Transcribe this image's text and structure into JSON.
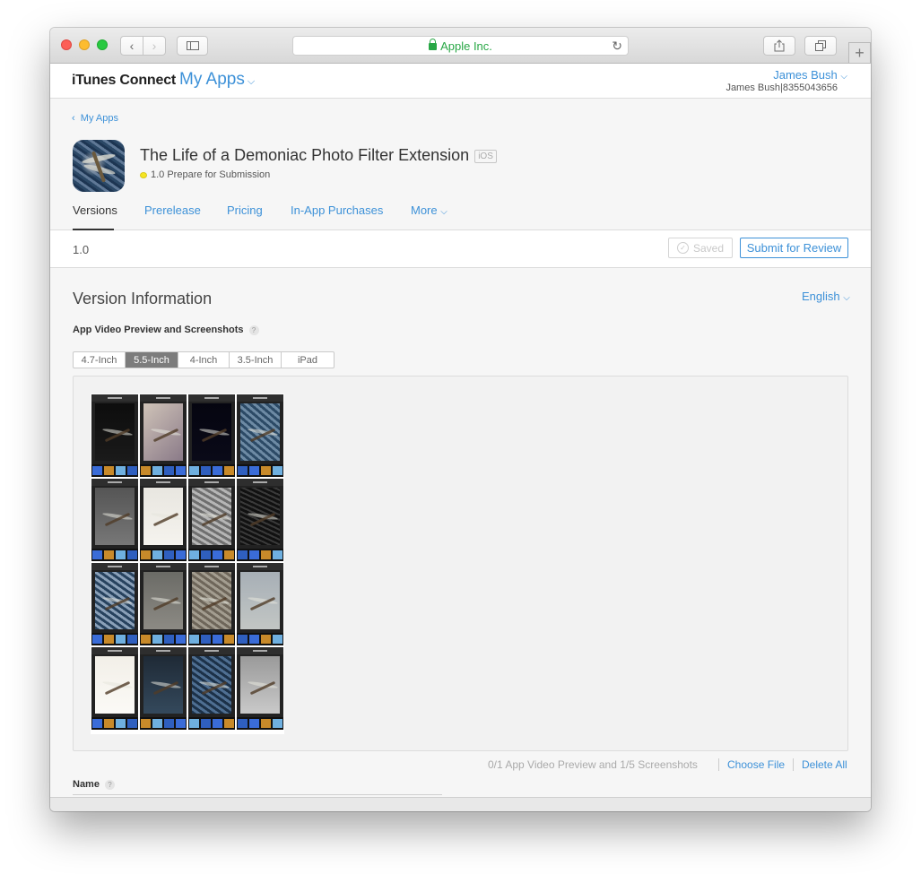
{
  "browser": {
    "address": "Apple Inc."
  },
  "header": {
    "brand": "iTunes Connect",
    "my_apps": "My Apps",
    "user_name": "James Bush",
    "user_id": "James Bush|8355043656"
  },
  "app": {
    "breadcrumb": "My Apps",
    "title": "The Life of a Demoniac Photo Filter Extension",
    "platform": "iOS",
    "status": "1.0 Prepare for Submission",
    "status_color": "#f6e523",
    "tabs": [
      {
        "label": "Versions",
        "active": true
      },
      {
        "label": "Prerelease"
      },
      {
        "label": "Pricing"
      },
      {
        "label": "In-App Purchases"
      },
      {
        "label": "More"
      }
    ]
  },
  "version_bar": {
    "version": "1.0",
    "saved_label": "Saved",
    "submit_label": "Submit for Review"
  },
  "version_info": {
    "title": "Version Information",
    "language": "English",
    "preview_label": "App Video Preview and Screenshots",
    "help": "?",
    "device_tabs": [
      "4.7-Inch",
      "5.5-Inch",
      "4-Inch",
      "3.5-Inch",
      "iPad"
    ],
    "active_device": "5.5-Inch",
    "screenshot_tile_label": "Photo Filter",
    "screenshot_count": 16,
    "count_text": "0/1 App Video Preview and 1/5 Screenshots",
    "choose_file": "Choose File",
    "delete_all": "Delete All",
    "name_label": "Name"
  },
  "colors": {
    "accent": "#3d91d8"
  }
}
